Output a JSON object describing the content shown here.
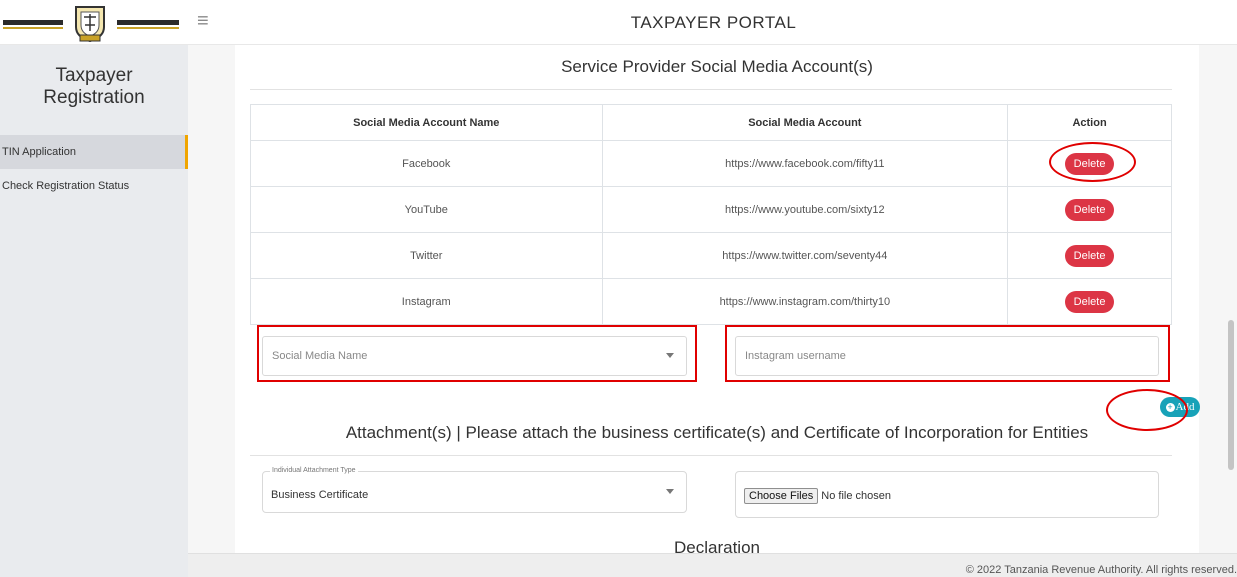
{
  "header": {
    "title": "TAXPAYER PORTAL"
  },
  "sidebar": {
    "title": "Taxpayer Registration",
    "items": [
      {
        "label": "TIN Application"
      },
      {
        "label": "Check Registration Status"
      }
    ]
  },
  "social": {
    "title": "Service Provider Social Media Account(s)",
    "columns": [
      "Social Media Account Name",
      "Social Media Account",
      "Action"
    ],
    "rows": [
      {
        "name": "Facebook",
        "account": "https://www.facebook.com/fifty11",
        "action": "Delete"
      },
      {
        "name": "YouTube",
        "account": "https://www.youtube.com/sixty12",
        "action": "Delete"
      },
      {
        "name": "Twitter",
        "account": "https://www.twitter.com/seventy44",
        "action": "Delete"
      },
      {
        "name": "Instagram",
        "account": "https://www.instagram.com/thirty10",
        "action": "Delete"
      }
    ],
    "name_select_placeholder": "Social Media Name",
    "username_placeholder": "Instagram username",
    "add_label": "Add"
  },
  "attachments": {
    "title": "Attachment(s) | Please attach the business certificate(s) and Certificate of Incorporation for Entities",
    "type_legend": "Individual Attachment Type",
    "type_value": "Business Certificate",
    "choose_label": "Choose Files",
    "file_status": "No file chosen"
  },
  "declaration": {
    "title": "Declaration"
  },
  "footer": {
    "text": "© 2022 Tanzania Revenue Authority. All rights reserved."
  },
  "colors": {
    "danger": "#dc3545",
    "info": "#17a2b8",
    "annotation": "#e00000",
    "active_marker": "#f0a500"
  }
}
